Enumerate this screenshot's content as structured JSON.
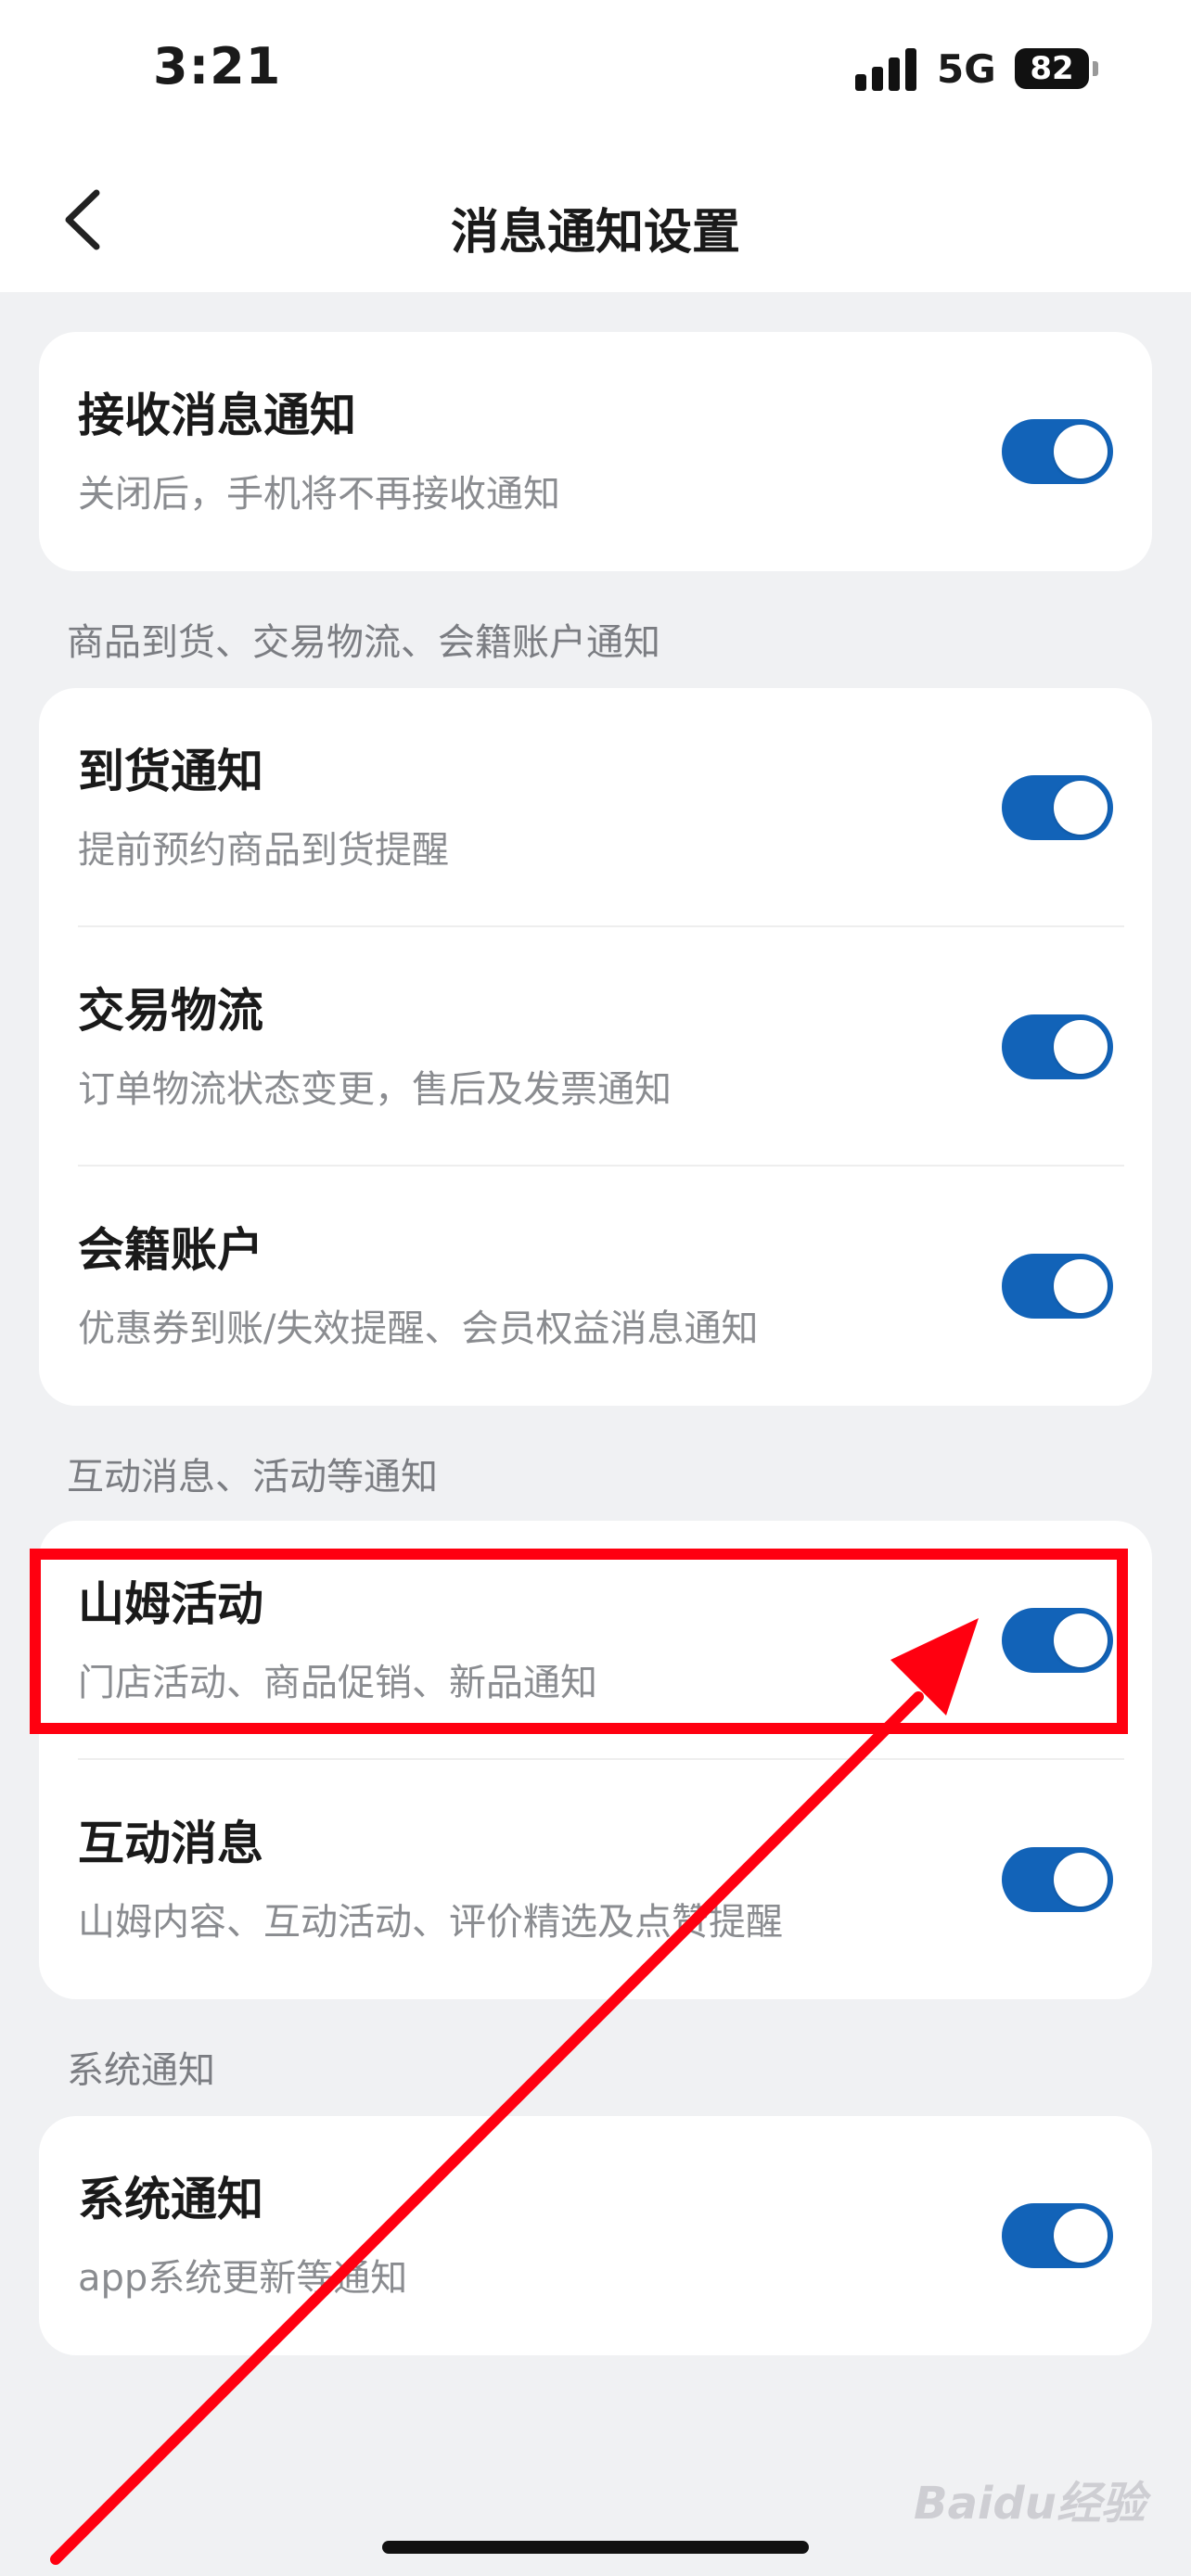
{
  "status": {
    "time": "3:21",
    "network": "5G",
    "battery": "82"
  },
  "nav": {
    "title": "消息通知设置"
  },
  "master": {
    "title": "接收消息通知",
    "subtitle": "关闭后，手机将不再接收通知",
    "enabled": true
  },
  "sections": [
    {
      "header": "商品到货、交易物流、会籍账户通知",
      "items": [
        {
          "title": "到货通知",
          "subtitle": "提前预约商品到货提醒",
          "enabled": true
        },
        {
          "title": "交易物流",
          "subtitle": "订单物流状态变更，售后及发票通知",
          "enabled": true
        },
        {
          "title": "会籍账户",
          "subtitle": "优惠券到账/失效提醒、会员权益消息通知",
          "enabled": true
        }
      ]
    },
    {
      "header": "互动消息、活动等通知",
      "items": [
        {
          "title": "山姆活动",
          "subtitle": "门店活动、商品促销、新品通知",
          "enabled": true
        },
        {
          "title": "互动消息",
          "subtitle": "山姆内容、互动活动、评价精选及点赞提醒",
          "enabled": true
        }
      ]
    },
    {
      "header": "系统通知",
      "items": [
        {
          "title": "系统通知",
          "subtitle": "app系统更新等通知",
          "enabled": true
        }
      ]
    }
  ],
  "watermark": "Baidu经验",
  "colors": {
    "toggle_on": "#1263b8",
    "annotation": "#ff0010",
    "background": "#f0f1f3"
  }
}
